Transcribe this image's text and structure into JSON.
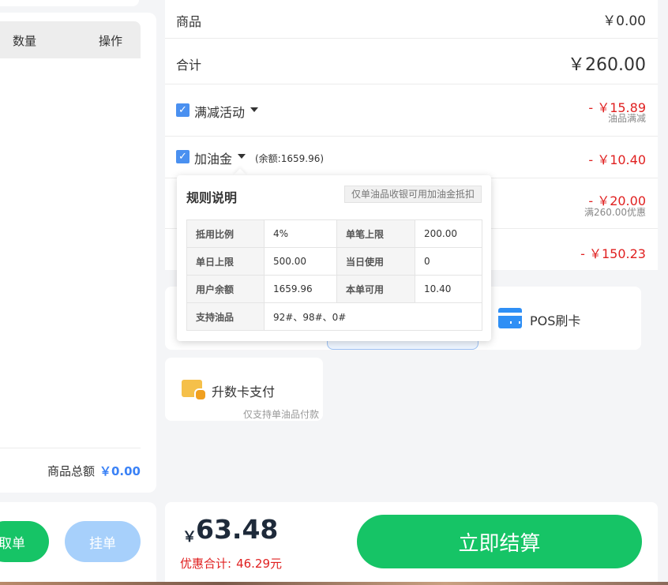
{
  "left": {
    "headers": {
      "qty": "数量",
      "op": "操作"
    },
    "goods_total_label": "商品总额",
    "goods_total_value": "￥0.00",
    "take_button": "取单",
    "hold_button": "挂单"
  },
  "summary": {
    "goods_label": "商品",
    "goods_value": "￥0.00",
    "total_label": "合计",
    "total_value": "￥260.00",
    "promo_label": "满减活动",
    "promo_value": "- ￥15.89",
    "promo_sub": "油品满减",
    "fuel_label": "加油金",
    "fuel_balance": "(余额:1659.96)",
    "fuel_value": "- ￥10.40",
    "row4_value": "- ￥20.00",
    "row4_sub": "满260.00优惠",
    "row5_value": "- ￥150.23"
  },
  "tooltip": {
    "title": "规则说明",
    "note": "仅单油品收银可用加油金抵扣",
    "rows": [
      [
        "抵用比例",
        "4%",
        "单笔上限",
        "200.00"
      ],
      [
        "单日上限",
        "500.00",
        "当日使用",
        "0"
      ],
      [
        "用户余额",
        "1659.96",
        "本单可用",
        "10.40"
      ],
      [
        "支持油品",
        "92#、98#、0#"
      ]
    ]
  },
  "payment": {
    "pos_label": "POS刷卡",
    "upgrade_label": "升数卡支付",
    "upgrade_sub": "仅支持单油品付款"
  },
  "checkout": {
    "currency": "￥",
    "amount": "63.48",
    "discount_label": "优惠合计:",
    "discount_value": "46.29元",
    "settle_button": "立即结算"
  },
  "colors": {
    "accent_green": "#16c466",
    "accent_blue": "#3b82f6",
    "discount_red": "#e02020"
  },
  "icons": [
    "checkbox-checked-icon",
    "caret-down-icon",
    "pos-card-icon",
    "upgrade-card-icon"
  ]
}
